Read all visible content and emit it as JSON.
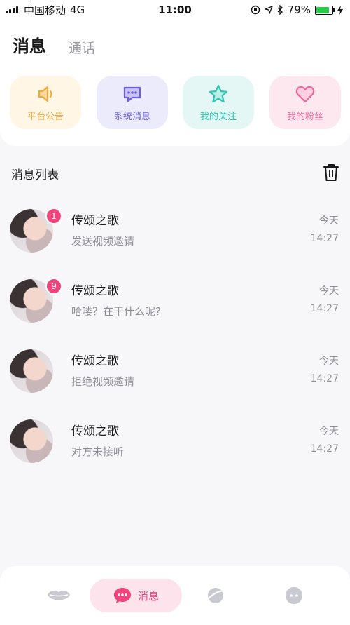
{
  "status_bar": {
    "carrier": "中国移动",
    "network": "4G",
    "time": "11:00",
    "battery": "79%"
  },
  "header": {
    "tabs": [
      {
        "label": "消息",
        "active": true
      },
      {
        "label": "通话",
        "active": false
      }
    ]
  },
  "categories": [
    {
      "label": "平台公告",
      "icon": "speaker-icon",
      "color": "#f0a93c"
    },
    {
      "label": "系统消息",
      "icon": "chat-dots-icon",
      "color": "#6a5fe0"
    },
    {
      "label": "我的关注",
      "icon": "star-icon",
      "color": "#2fc5b2"
    },
    {
      "label": "我的粉丝",
      "icon": "heart-icon",
      "color": "#f2679a"
    }
  ],
  "list": {
    "title": "消息列表",
    "delete_icon": "trash-icon",
    "items": [
      {
        "name": "传颂之歌",
        "preview": "发送视频邀请",
        "day": "今天",
        "time": "14:27",
        "badge": "1"
      },
      {
        "name": "传颂之歌",
        "preview": "哈喽？在干什么呢?",
        "day": "今天",
        "time": "14:27",
        "badge": "9"
      },
      {
        "name": "传颂之歌",
        "preview": "拒绝视频邀请",
        "day": "今天",
        "time": "14:27",
        "badge": null
      },
      {
        "name": "传颂之歌",
        "preview": "对方未接听",
        "day": "今天",
        "time": "14:27",
        "badge": null
      }
    ]
  },
  "bottom_nav": {
    "items": [
      {
        "icon": "lips-icon",
        "label": ""
      },
      {
        "icon": "message-icon",
        "label": "消息",
        "active": true
      },
      {
        "icon": "planet-icon",
        "label": ""
      },
      {
        "icon": "profile-icon",
        "label": ""
      }
    ],
    "accent": "#f0457c"
  }
}
